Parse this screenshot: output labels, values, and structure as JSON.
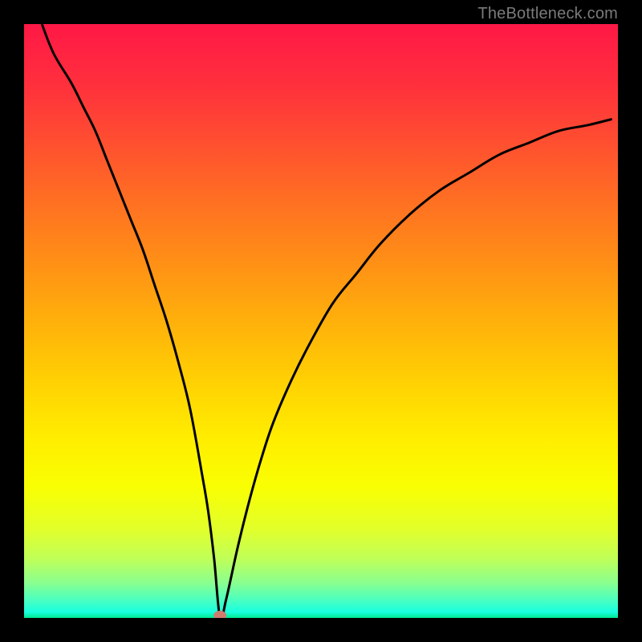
{
  "watermark": "TheBottleneck.com",
  "chart_data": {
    "type": "line",
    "title": "",
    "xlabel": "",
    "ylabel": "",
    "xlim": [
      0,
      100
    ],
    "ylim": [
      0,
      100
    ],
    "marker": {
      "x": 33,
      "y": 0,
      "color": "#cf7b6e"
    },
    "series": [
      {
        "name": "curve",
        "x": [
          3,
          5,
          8,
          10,
          12,
          14,
          16,
          18,
          20,
          22,
          24,
          26,
          28,
          30,
          31,
          32,
          33,
          34,
          36,
          38,
          40,
          42,
          45,
          48,
          52,
          56,
          60,
          65,
          70,
          75,
          80,
          85,
          90,
          95,
          99
        ],
        "values": [
          100,
          95,
          90,
          86,
          82,
          77,
          72,
          67,
          62,
          56,
          50,
          43,
          35,
          24,
          18,
          10,
          0,
          3,
          12,
          20,
          27,
          33,
          40,
          46,
          53,
          58,
          63,
          68,
          72,
          75,
          78,
          80,
          82,
          83,
          84
        ]
      }
    ],
    "background_gradient_stops": [
      {
        "offset": 0.0,
        "color": "#ff1846"
      },
      {
        "offset": 0.1,
        "color": "#ff2f3d"
      },
      {
        "offset": 0.2,
        "color": "#ff4f30"
      },
      {
        "offset": 0.3,
        "color": "#ff7022"
      },
      {
        "offset": 0.4,
        "color": "#ff8f16"
      },
      {
        "offset": 0.5,
        "color": "#ffb00b"
      },
      {
        "offset": 0.6,
        "color": "#ffd003"
      },
      {
        "offset": 0.7,
        "color": "#ffee00"
      },
      {
        "offset": 0.78,
        "color": "#f9ff03"
      },
      {
        "offset": 0.85,
        "color": "#e2ff2a"
      },
      {
        "offset": 0.9,
        "color": "#c0ff58"
      },
      {
        "offset": 0.94,
        "color": "#8bff8e"
      },
      {
        "offset": 0.97,
        "color": "#4affc0"
      },
      {
        "offset": 0.99,
        "color": "#18ffe0"
      },
      {
        "offset": 1.0,
        "color": "#00e890"
      }
    ]
  }
}
